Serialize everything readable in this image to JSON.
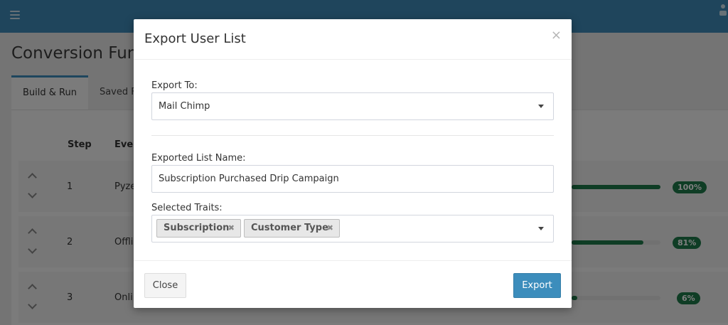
{
  "app": {
    "page_title": "Conversion Funn",
    "tabs": [
      {
        "label": "Build & Run"
      },
      {
        "label": "Saved F"
      }
    ]
  },
  "table": {
    "headers": {
      "step": "Step",
      "event": "Even"
    },
    "rows": [
      {
        "step": "1",
        "event": "Pyze",
        "percent": "100%",
        "fill": 1.0
      },
      {
        "step": "2",
        "event": "Offli",
        "percent": "81%",
        "fill": 0.81
      },
      {
        "step": "3",
        "event": "Onli",
        "percent": "6%",
        "fill": 0.06
      }
    ]
  },
  "modal": {
    "title": "Export User List",
    "close_icon": "×",
    "export_to": {
      "label": "Export To:",
      "value": "Mail Chimp"
    },
    "list_name": {
      "label": "Exported List Name:",
      "value": "Subscription Purchased Drip Campaign"
    },
    "traits": {
      "label": "Selected Traits:",
      "tags": [
        {
          "label": "Subscription",
          "remove": "✖"
        },
        {
          "label": "Customer Type",
          "remove": "✖"
        }
      ]
    },
    "footer": {
      "close_label": "Close",
      "export_label": "Export"
    }
  },
  "colors": {
    "topbar": "#3f8bb8",
    "primary": "#3c8dbc",
    "success": "#1e7a4a"
  },
  "icons": {
    "menu": "hamburger-icon",
    "close": "close-icon",
    "sort_up": "chevron-up-icon",
    "sort_down": "chevron-down-icon",
    "dropdown": "caret-down-icon",
    "remove_tag": "remove-icon"
  }
}
